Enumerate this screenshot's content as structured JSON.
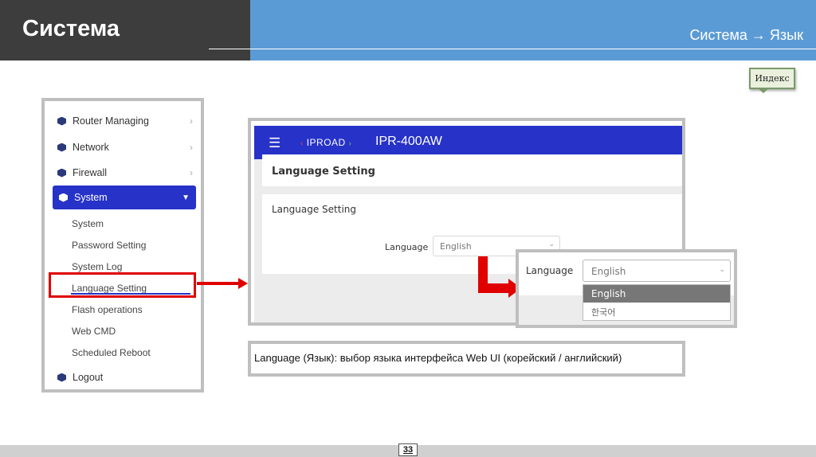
{
  "header": {
    "title": "Система",
    "breadcrumb": "Система → Язык"
  },
  "index_button": {
    "label": "Индекс"
  },
  "sidebar": {
    "items": [
      {
        "label": "Router Managing"
      },
      {
        "label": "Network"
      },
      {
        "label": "Firewall"
      }
    ],
    "active": {
      "label": "System"
    },
    "subitems": [
      {
        "label": "System"
      },
      {
        "label": "Password Setting"
      },
      {
        "label": "System Log"
      },
      {
        "label": "Language Setting"
      },
      {
        "label": "Flash operations"
      },
      {
        "label": "Web CMD"
      },
      {
        "label": "Scheduled Reboot"
      }
    ],
    "logout": {
      "label": "Logout"
    }
  },
  "screenshot": {
    "logo": "IPROAD",
    "model": "IPR-400AW",
    "page_heading": "Language Setting",
    "card_title": "Language Setting",
    "language_label": "Language",
    "language_value": "English"
  },
  "dropdown": {
    "label": "Language",
    "selected": "English",
    "options": [
      "English",
      "한국어"
    ]
  },
  "description": "Language (Язык): выбор языка интерфейса Web UI (корейский / английский)",
  "footer": {
    "page": "33"
  },
  "colors": {
    "header_dark": "#3d3d3d",
    "header_blue": "#5b9bd5",
    "accent": "#2632c8",
    "highlight_red": "#e00000"
  }
}
